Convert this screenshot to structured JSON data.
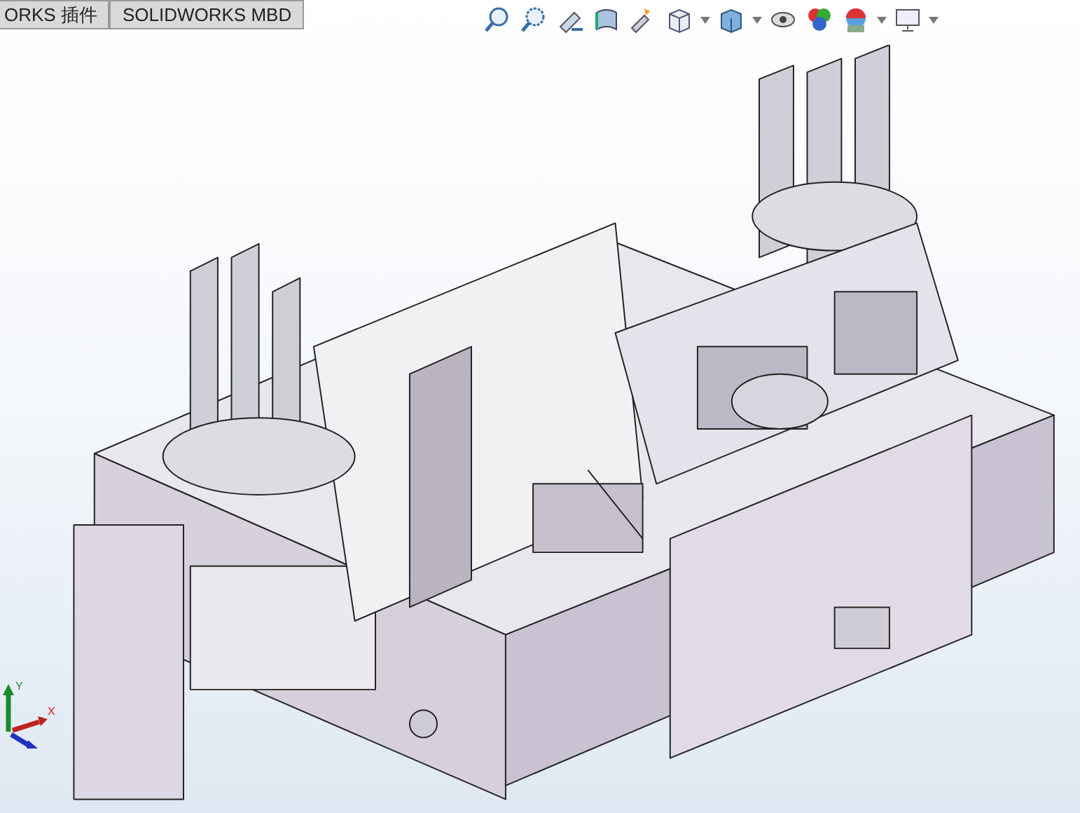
{
  "tabs": [
    {
      "label": "ORKS 插件",
      "selected": false
    },
    {
      "label": "SOLIDWORKS MBD",
      "selected": false
    }
  ],
  "triad": {
    "x_label": "X",
    "y_label": "Y"
  }
}
